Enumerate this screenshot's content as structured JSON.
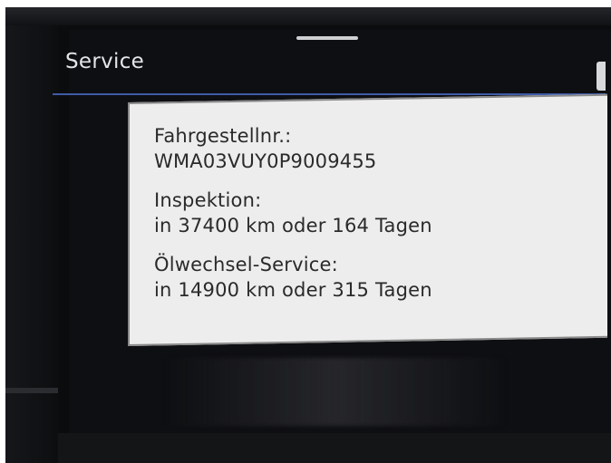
{
  "screen": {
    "title": "Service",
    "accent_color": "#3e5ba8",
    "panel_background": "#ededed"
  },
  "service_info": {
    "vin_label": "Fahrgestellnr.:",
    "vin_value": "WMA03VUY0P9009455",
    "inspection_label": "Inspektion:",
    "inspection_value": "in 37400 km oder 164 Tagen",
    "oil_label": "Ölwechsel-Service:",
    "oil_value": "in 14900 km oder 315 Tagen"
  }
}
